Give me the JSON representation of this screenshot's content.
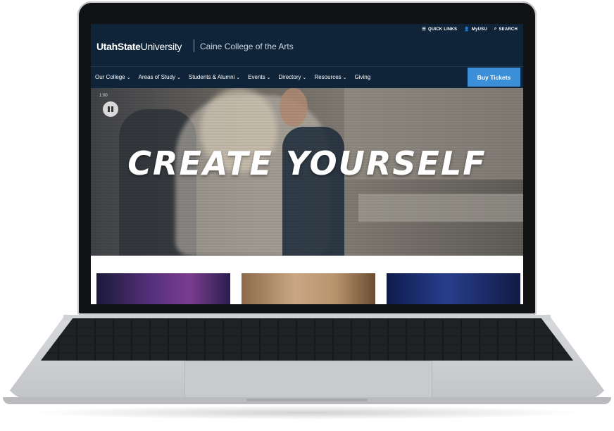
{
  "header": {
    "utility_links": [
      {
        "icon": "list-icon",
        "label": "QUICK LINKS"
      },
      {
        "icon": "user-icon",
        "label": "MyUSU"
      },
      {
        "icon": "search-icon",
        "label": "SEARCH"
      }
    ],
    "logo_bold": "UtahState",
    "logo_regular": "University",
    "college": "Caine College of the Arts"
  },
  "nav": {
    "items": [
      {
        "label": "Our College",
        "has_dropdown": true
      },
      {
        "label": "Areas of Study",
        "has_dropdown": true
      },
      {
        "label": "Students & Alumni",
        "has_dropdown": true
      },
      {
        "label": "Events",
        "has_dropdown": true
      },
      {
        "label": "Directory",
        "has_dropdown": true
      },
      {
        "label": "Resources",
        "has_dropdown": true
      },
      {
        "label": "Giving",
        "has_dropdown": false
      }
    ],
    "cta": "Buy Tickets"
  },
  "hero": {
    "timestamp": "1:00",
    "tagline": "CREATE YOURSELF",
    "control_icon": "pause-icon"
  },
  "colors": {
    "header_bg": "#0f2439",
    "cta_bg": "#3b8fd8",
    "text_light": "#ffffff"
  }
}
